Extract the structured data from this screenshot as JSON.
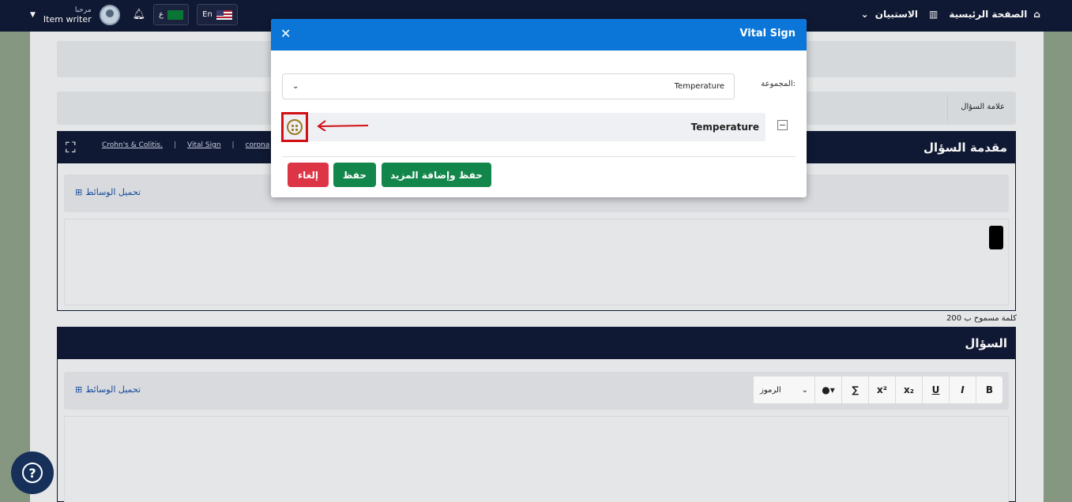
{
  "topbar": {
    "home": "الصفحة الرئيسية",
    "survey": "الاستبيان",
    "greeting": "مرحبا",
    "user": "Item writer",
    "lang_en": "En",
    "lang_ar": "ع"
  },
  "form": {
    "question_mark_label": "علامة السؤال",
    "intro_title": "مقدمة السؤال",
    "intro_links": [
      "Crohn's & Colitis.",
      "|",
      "Vital Sign",
      "|",
      "corona"
    ],
    "upload_label": "تحميل الوسائط",
    "symbols_label": "الرموز",
    "word_limit": "200 كلمة مسموح ب",
    "question_title": "السؤال",
    "toolbar": [
      "B",
      "I",
      "U",
      "x₂",
      "x²",
      "∑"
    ]
  },
  "modal": {
    "title": "Vital Sign",
    "group_label": "المجموعة:",
    "group_value": "Temperature",
    "item_label": "Temperature",
    "btn_save_more": "حفظ وإضافة المزيد",
    "btn_save": "حفظ",
    "btn_cancel": "إلغاء"
  },
  "colors": {
    "navy": "#111a35",
    "modal_blue": "#0b76d8",
    "green": "#13874b",
    "red": "#dc3545",
    "highlight": "#d20f14"
  }
}
